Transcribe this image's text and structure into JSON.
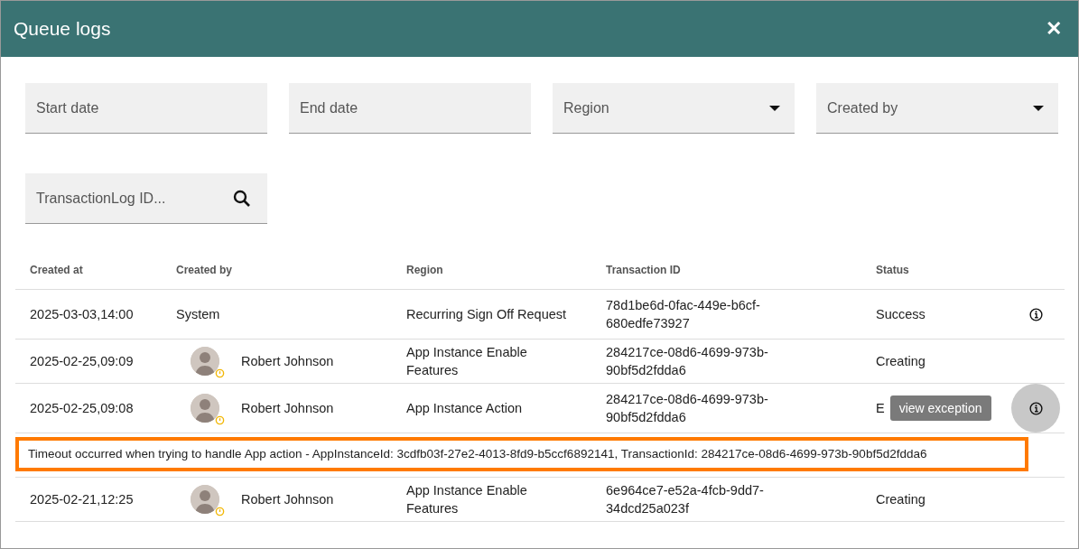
{
  "dialog": {
    "title": "Queue logs",
    "close": "✕"
  },
  "filters": [
    {
      "kind": "text",
      "placeholder": "Start date"
    },
    {
      "kind": "text",
      "placeholder": "End date"
    },
    {
      "kind": "select",
      "placeholder": "Region"
    },
    {
      "kind": "select",
      "placeholder": "Created by"
    },
    {
      "kind": "search",
      "placeholder": "TransactionLog ID..."
    }
  ],
  "table": {
    "columns": [
      "Created at",
      "Created by",
      "Region",
      "Transaction ID",
      "Status"
    ],
    "rows": [
      {
        "created_at": "2025-03-03,14:00",
        "created_by": {
          "kind": "system",
          "name": "System"
        },
        "region": "Recurring Sign Off Request",
        "transaction_id": "78d1be6d-0fac-449e-b6cf-680edfe73927",
        "status": "Success",
        "info": true,
        "hovered": false
      },
      {
        "created_at": "2025-02-25,09:09",
        "created_by": {
          "kind": "user",
          "name": "Robert Johnson"
        },
        "region": "App Instance Enable Features",
        "transaction_id": "284217ce-08d6-4699-973b-90bf5d2fdda6",
        "status": "Creating",
        "info": false,
        "hovered": false
      },
      {
        "created_at": "2025-02-25,09:08",
        "created_by": {
          "kind": "user",
          "name": "Robert Johnson"
        },
        "region": "App Instance Action",
        "transaction_id": "284217ce-08d6-4699-973b-90bf5d2fdda6",
        "status": "E",
        "info": true,
        "hovered": true,
        "tooltip": "view exception",
        "exception": "Timeout occurred when trying to handle App action - AppInstanceId: 3cdfb03f-27e2-4013-8fd9-b5ccf6892141, TransactionId: 284217ce-08d6-4699-973b-90bf5d2fdda6"
      },
      {
        "created_at": "2025-02-21,12:25",
        "created_by": {
          "kind": "user",
          "name": "Robert Johnson"
        },
        "region": "App Instance Enable Features",
        "transaction_id": "6e964ce7-e52a-4fcb-9dd7-34dcd25a023f",
        "status": "Creating",
        "info": false,
        "hovered": false
      }
    ]
  }
}
